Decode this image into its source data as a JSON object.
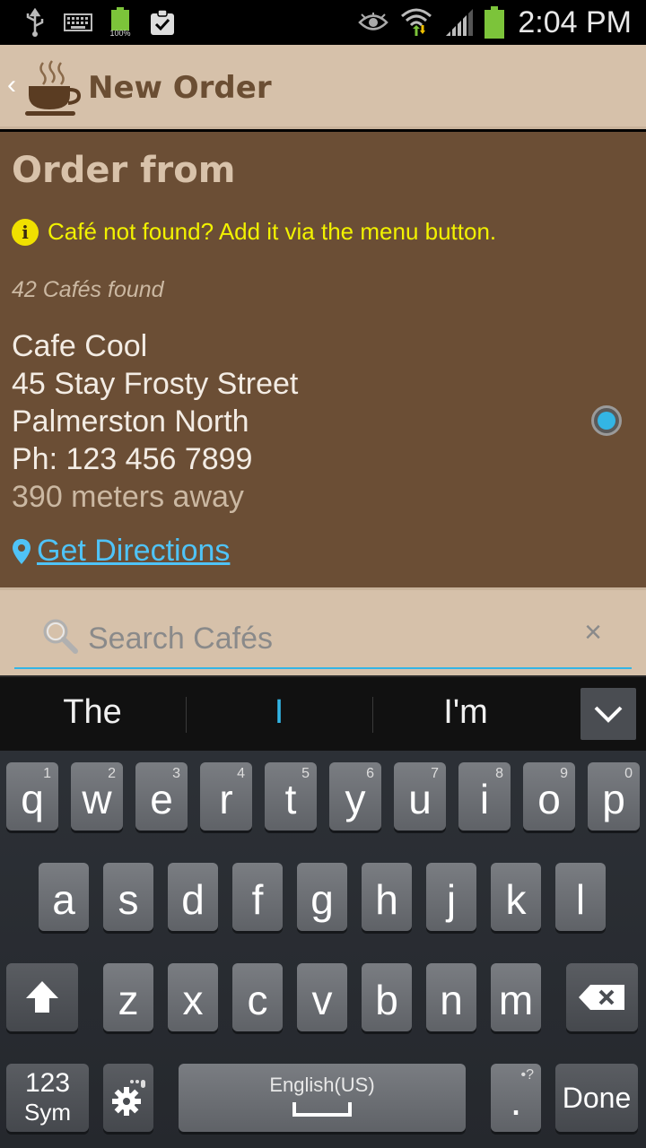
{
  "status_bar": {
    "time": "2:04 PM",
    "battery_small_label": "100%",
    "icons": [
      "usb-icon",
      "keyboard-icon",
      "battery-full-icon",
      "clipboard-check-icon",
      "eye-icon",
      "wifi-icon",
      "signal-icon",
      "battery-icon"
    ]
  },
  "action_bar": {
    "title": "New Order",
    "up_glyph": "‹"
  },
  "main": {
    "heading": "Order from",
    "hint_icon": "i",
    "hint_text": "Café not found? Add it via the menu button.",
    "count_text": "42 Cafés found",
    "cafe": {
      "name": "Cafe Cool",
      "street": "45 Stay Frosty Street",
      "city": "Palmerston North",
      "phone": "Ph: 123 456 7899",
      "distance": "390 meters away",
      "selected": true
    },
    "directions_label": "Get Directions"
  },
  "search": {
    "placeholder": "Search Cafés",
    "value": "",
    "clear_glyph": "×"
  },
  "keyboard": {
    "suggestions": [
      "The",
      "I",
      "I'm"
    ],
    "row1": [
      {
        "char": "q",
        "hint": "1"
      },
      {
        "char": "w",
        "hint": "2"
      },
      {
        "char": "e",
        "hint": "3"
      },
      {
        "char": "r",
        "hint": "4"
      },
      {
        "char": "t",
        "hint": "5"
      },
      {
        "char": "y",
        "hint": "6"
      },
      {
        "char": "u",
        "hint": "7"
      },
      {
        "char": "i",
        "hint": "8"
      },
      {
        "char": "o",
        "hint": "9"
      },
      {
        "char": "p",
        "hint": "0"
      }
    ],
    "row2": [
      "a",
      "s",
      "d",
      "f",
      "g",
      "h",
      "j",
      "k",
      "l"
    ],
    "row3": [
      "z",
      "x",
      "c",
      "v",
      "b",
      "n",
      "m"
    ],
    "sym_top": "123",
    "sym_bottom": "Sym",
    "space_label": "English(US)",
    "period": ".",
    "period_hint": "•?",
    "done_label": "Done",
    "accent_color": "#33b5e5"
  }
}
